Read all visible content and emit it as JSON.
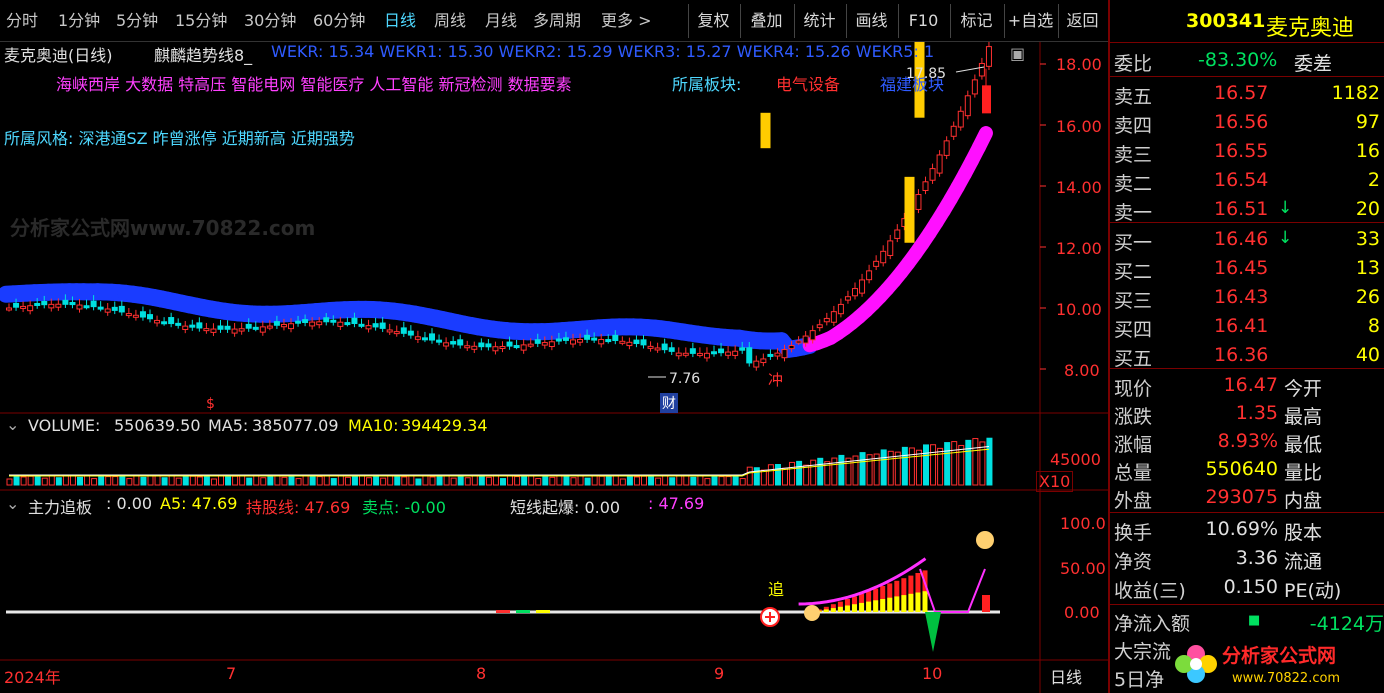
{
  "toolbar": {
    "periods": [
      {
        "label": "分时"
      },
      {
        "label": "1分钟"
      },
      {
        "label": "5分钟"
      },
      {
        "label": "15分钟"
      },
      {
        "label": "30分钟"
      },
      {
        "label": "60分钟"
      },
      {
        "label": "日线"
      },
      {
        "label": "周线"
      },
      {
        "label": "月线"
      },
      {
        "label": "多周期"
      },
      {
        "label": "更多 >"
      }
    ],
    "tools": [
      {
        "label": "复权"
      },
      {
        "label": "叠加"
      },
      {
        "label": "统计"
      },
      {
        "label": "画线"
      },
      {
        "label": "F10"
      },
      {
        "label": "标记"
      },
      {
        "label": "+自选"
      },
      {
        "label": "返回"
      }
    ]
  },
  "main": {
    "title": "麦克奥迪(日线)",
    "indicator_name": "麒麟趋势线8_",
    "wekr": "WEKR: 15.34  WEKR1: 15.30  WEKR2: 15.29  WEKR3: 15.27  WEKR4: 15.26  WEKR5: 1",
    "concepts": "海峡西岸 大数据 特高压 智能电网 智能医疗 人工智能 新冠检测 数据要素",
    "sector_label": "所属板块:",
    "sector_value": "电气设备",
    "region_value": "福建板块",
    "style_line": "所属风格: 深港通SZ 昨曾涨停 近期新高 近期强势",
    "high_label": "17.85",
    "low_label": "7.76",
    "marker_cai": "财",
    "marker_chong": "冲",
    "marker_s": "$",
    "price_axis": [
      "18.00",
      "16.00",
      "14.00",
      "12.00",
      "10.00",
      "8.00"
    ],
    "watermark": "分析家公式网www.70822.com"
  },
  "volume": {
    "label": "VOLUME:",
    "value": "550639.50",
    "ma5_label": "MA5:",
    "ma5": "385077.09",
    "ma10_label": "MA10:",
    "ma10": "394429.34",
    "axis": "45000",
    "axis_unit": "X10"
  },
  "sub": {
    "label": "主力追板",
    "value": ": 0.00",
    "a5": "A5: 47.69",
    "hold": "持股线: 47.69",
    "sell": "卖点: -0.00",
    "burst": "短线起爆: 0.00",
    "extra": ": 47.69",
    "axis": [
      "100.0",
      "50.00",
      "0.00"
    ],
    "marker_zhui": "追"
  },
  "date_axis": {
    "labels": [
      "2024年",
      "7",
      "8",
      "9",
      "10"
    ],
    "period": "日线"
  },
  "quote": {
    "code": "300341",
    "name": "麦克奥迪",
    "weibi_label": "委比",
    "weibi": "-83.30%",
    "weicha_label": "委差",
    "asks": [
      {
        "label": "卖五",
        "price": "16.57",
        "vol": "1182"
      },
      {
        "label": "卖四",
        "price": "16.56",
        "vol": "97"
      },
      {
        "label": "卖三",
        "price": "16.55",
        "vol": "16"
      },
      {
        "label": "卖二",
        "price": "16.54",
        "vol": "2"
      },
      {
        "label": "卖一",
        "price": "16.51",
        "vol": "20",
        "arrow": "↓"
      }
    ],
    "bids": [
      {
        "label": "买一",
        "price": "16.46",
        "vol": "33",
        "arrow": "↓"
      },
      {
        "label": "买二",
        "price": "16.45",
        "vol": "13"
      },
      {
        "label": "买三",
        "price": "16.43",
        "vol": "26"
      },
      {
        "label": "买四",
        "price": "16.41",
        "vol": "8"
      },
      {
        "label": "买五",
        "price": "16.36",
        "vol": "40"
      }
    ],
    "stats": [
      {
        "label": "现价",
        "value": "16.47",
        "label2": "今开",
        "color": "#ff3030"
      },
      {
        "label": "涨跌",
        "value": "1.35",
        "label2": "最高",
        "color": "#ff3030"
      },
      {
        "label": "涨幅",
        "value": "8.93%",
        "label2": "最低",
        "color": "#ff3030"
      },
      {
        "label": "总量",
        "value": "550640",
        "label2": "量比",
        "color": "#ffff00"
      },
      {
        "label": "外盘",
        "value": "293075",
        "label2": "内盘",
        "color": "#ff3030"
      }
    ],
    "fin": [
      {
        "label": "换手",
        "value": "10.69%",
        "label2": "股本"
      },
      {
        "label": "净资",
        "value": "3.36",
        "label2": "流通"
      },
      {
        "label": "收益(三)",
        "value": "0.150",
        "label2": "PE(动)"
      }
    ],
    "flow": [
      {
        "label": "净流入额",
        "value": "-4124万"
      },
      {
        "label": "大宗流",
        "value": ""
      },
      {
        "label": "5日净",
        "value": ""
      }
    ],
    "logo_text": "分析家公式网",
    "logo_url": "www.70822.com"
  },
  "colors": {
    "up": "#ff3030",
    "down": "#00e0e0",
    "ribbon_blue": "#1a3cff",
    "ribbon_mag": "#ff10ff",
    "accent": "#4ed8ff"
  }
}
